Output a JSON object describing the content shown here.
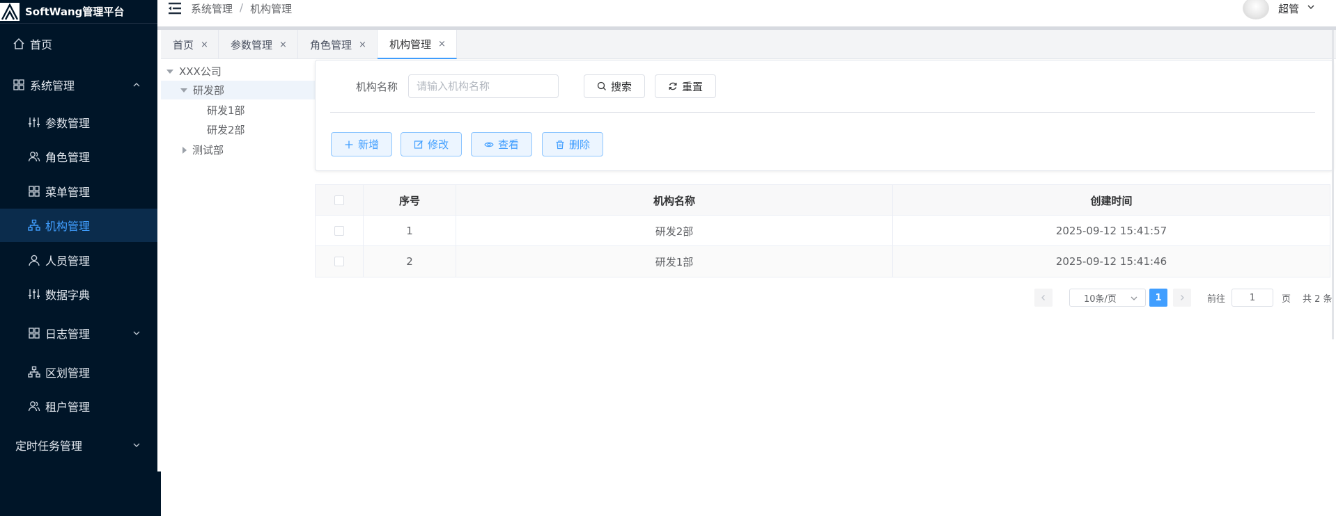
{
  "app": {
    "title": "SoftWang管理平台"
  },
  "sidebar": {
    "items": [
      {
        "label": "首页",
        "icon": "home-icon"
      },
      {
        "label": "系统管理",
        "icon": "grid-icon",
        "expanded": true
      },
      {
        "label": "参数管理",
        "icon": "sliders-icon"
      },
      {
        "label": "角色管理",
        "icon": "users-icon"
      },
      {
        "label": "菜单管理",
        "icon": "grid-icon"
      },
      {
        "label": "机构管理",
        "icon": "org-icon",
        "active": true
      },
      {
        "label": "人员管理",
        "icon": "user-icon"
      },
      {
        "label": "数据字典",
        "icon": "sliders-icon"
      },
      {
        "label": "日志管理",
        "icon": "grid-icon",
        "expanded": false
      },
      {
        "label": "区划管理",
        "icon": "org-icon"
      },
      {
        "label": "租户管理",
        "icon": "users-icon"
      },
      {
        "label": "定时任务管理",
        "expanded": false
      }
    ]
  },
  "header": {
    "breadcrumb": [
      "系统管理",
      "机构管理"
    ],
    "breadcrumb_sep": "/",
    "user_name": "超管"
  },
  "tabs": [
    {
      "label": "首页",
      "close": "×"
    },
    {
      "label": "参数管理",
      "close": "×"
    },
    {
      "label": "角色管理",
      "close": "×"
    },
    {
      "label": "机构管理",
      "close": "×",
      "active": true
    }
  ],
  "tree": [
    {
      "label": "XXX公司",
      "level": 0,
      "expanded": true
    },
    {
      "label": "研发部",
      "level": 1,
      "expanded": true,
      "selected": true
    },
    {
      "label": "研发1部",
      "level": 2
    },
    {
      "label": "研发2部",
      "level": 2
    },
    {
      "label": "测试部",
      "level": 1,
      "expanded": false
    }
  ],
  "search": {
    "label": "机构名称",
    "placeholder": "请输入机构名称",
    "search_btn": "搜索",
    "reset_btn": "重置"
  },
  "actions": {
    "add": "新增",
    "edit": "修改",
    "view": "查看",
    "delete": "删除"
  },
  "table": {
    "columns": [
      "序号",
      "机构名称",
      "创建时间"
    ],
    "rows": [
      {
        "index": "1",
        "name": "研发2部",
        "created": "2025-09-12 15:41:57"
      },
      {
        "index": "2",
        "name": "研发1部",
        "created": "2025-09-12 15:41:46"
      }
    ]
  },
  "pagination": {
    "page_size": "10条/页",
    "current_page": "1",
    "goto_label": "前往",
    "goto_value": "1",
    "page_unit": "页",
    "total": "共 2 条"
  },
  "colors": {
    "sidebar_bg": "#001528",
    "accent": "#409eff",
    "active_menu_bg": "#0b2c4c"
  }
}
